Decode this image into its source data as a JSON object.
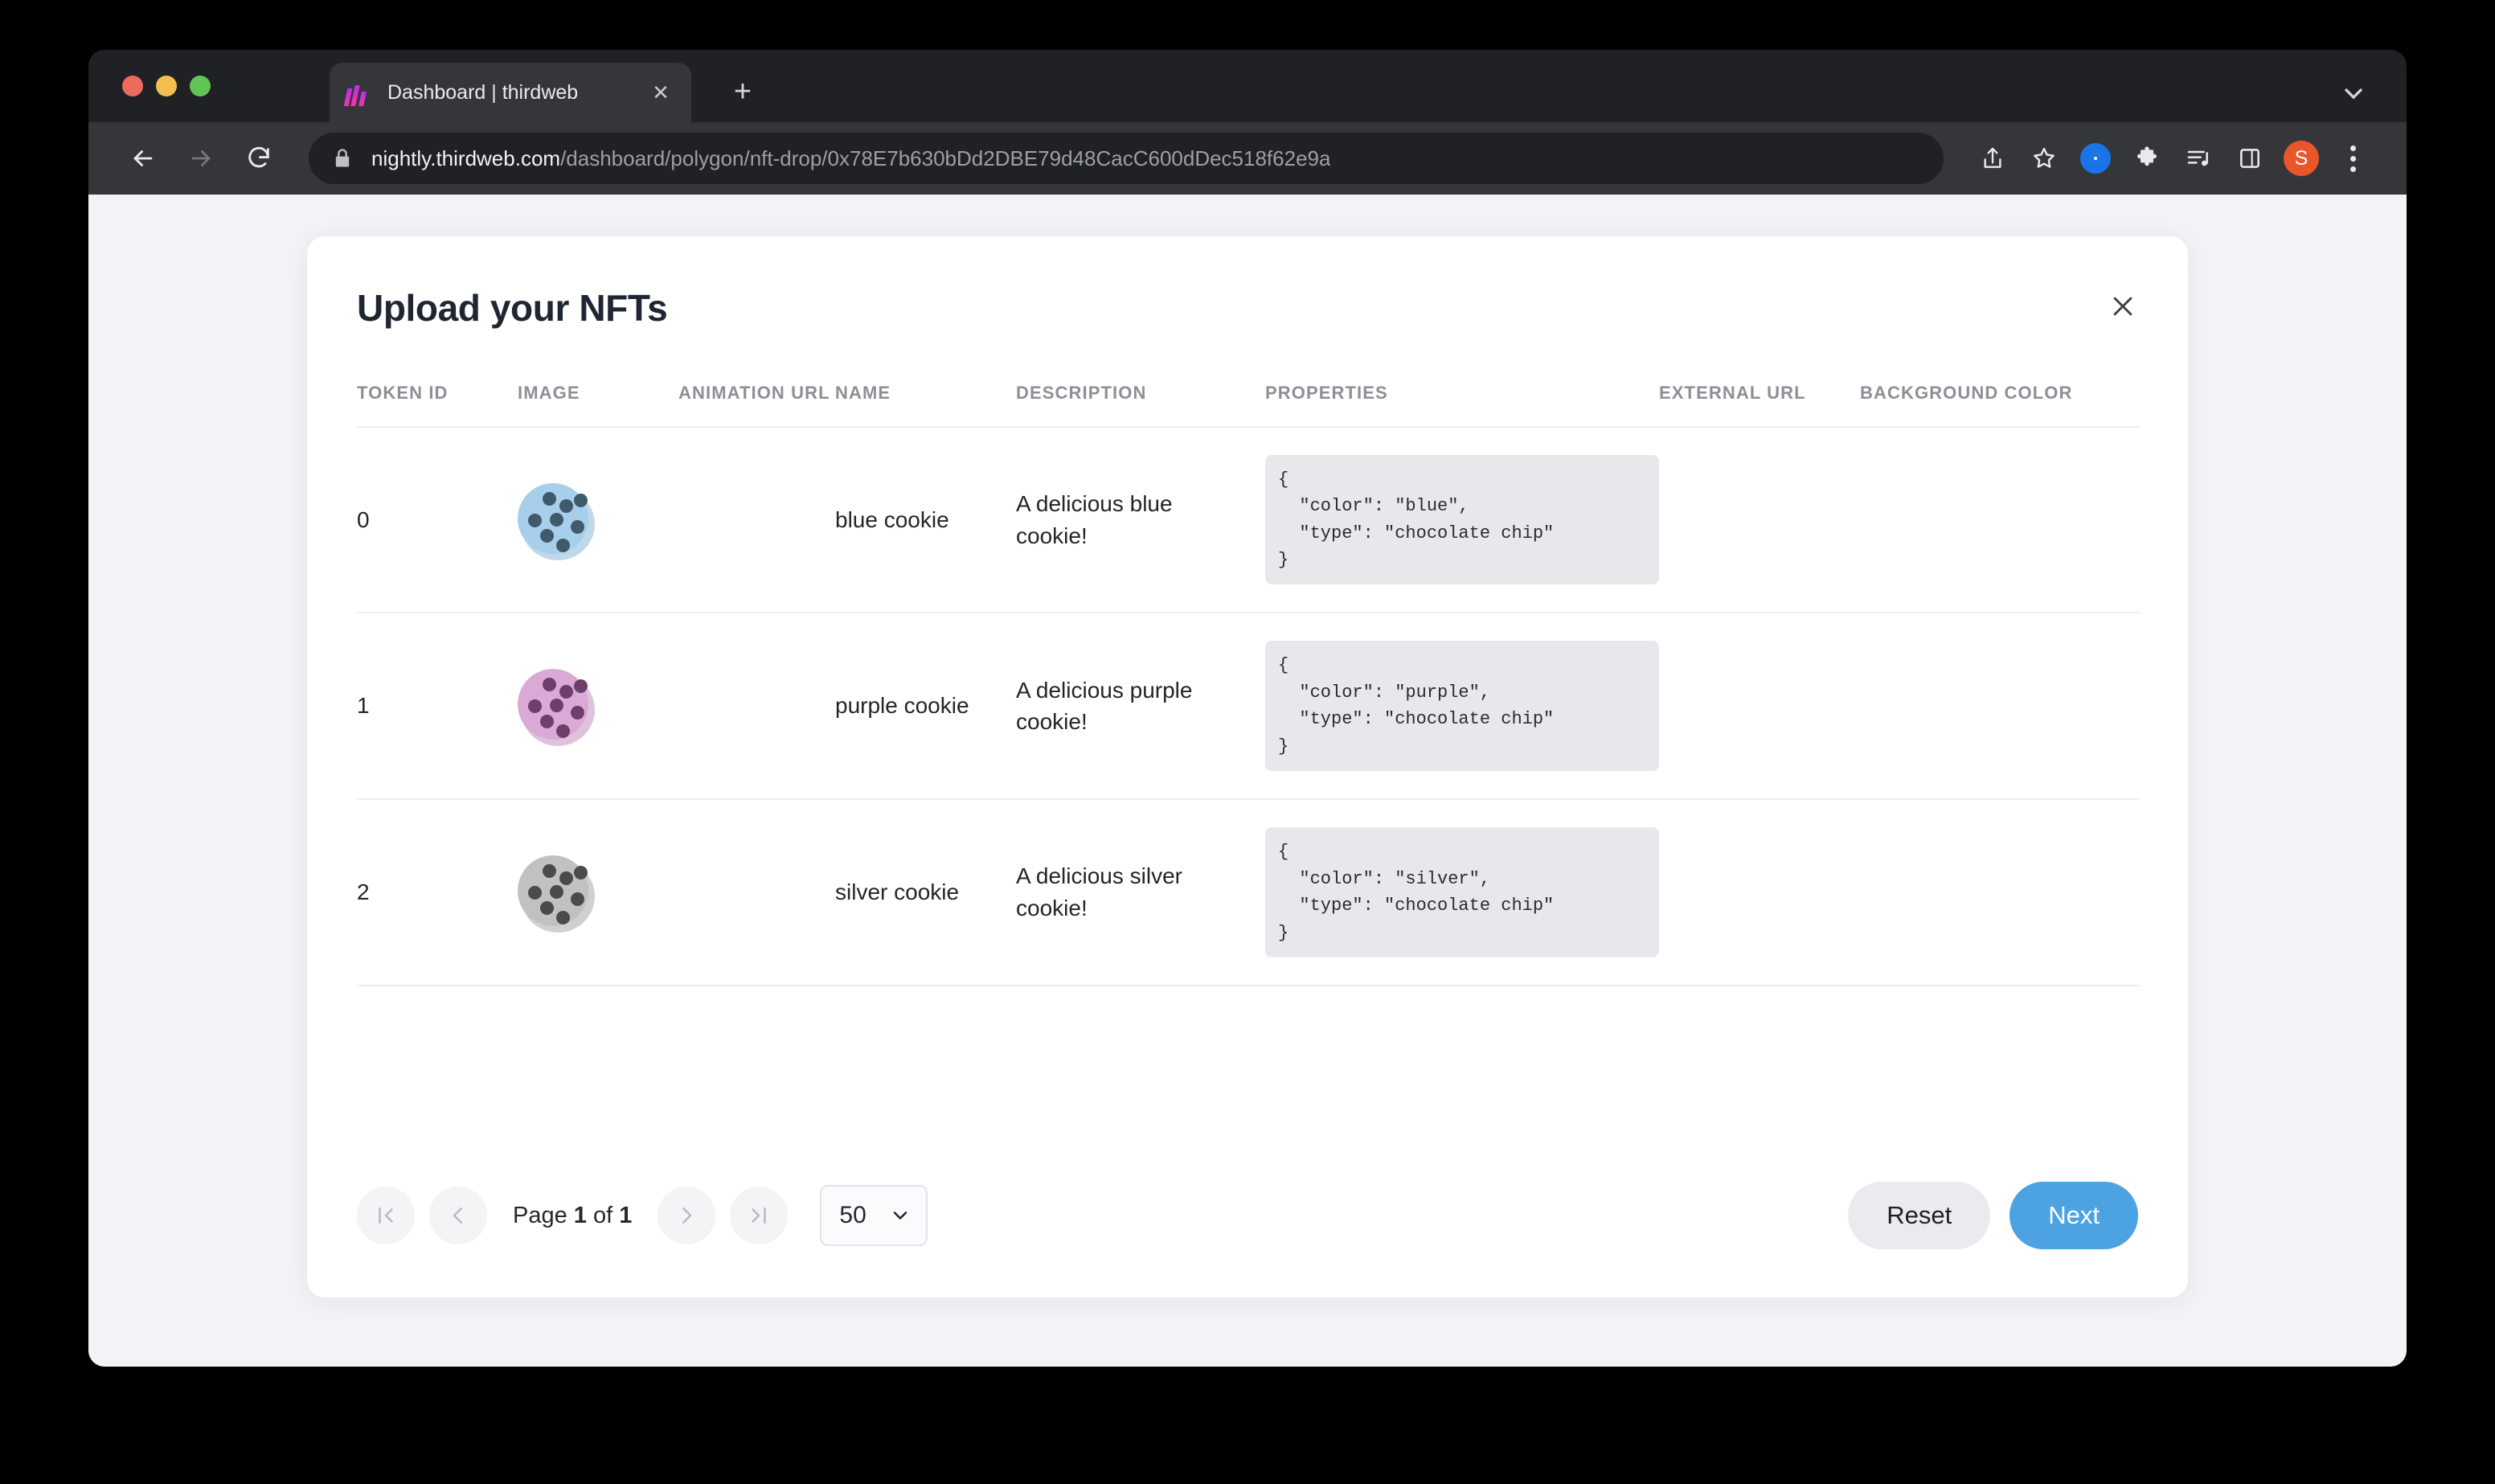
{
  "browser": {
    "tab": {
      "title": "Dashboard | thirdweb",
      "favicon_icon": "thirdweb-logo-icon",
      "close_icon": "close-icon"
    },
    "new_tab_icon": "plus-icon",
    "tabstrip_chevron_icon": "chevron-down-icon",
    "back_icon": "back-arrow-icon",
    "forward_icon": "forward-arrow-icon",
    "reload_icon": "reload-icon",
    "lock_icon": "lock-icon",
    "url_domain": "nightly.thirdweb.com",
    "url_path": "/dashboard/polygon/nft-drop/0x78E7b630bDd2DBE79d48CacC600dDec518f62e9a",
    "toolbar_icons": [
      "share-icon",
      "bookmark-star-icon",
      "extension-blue-circle-icon",
      "puzzle-piece-icon",
      "media-playlist-icon",
      "side-panel-icon"
    ],
    "profile_initial": "S",
    "menu_icon": "kebab-menu-icon"
  },
  "modal": {
    "title": "Upload your NFTs",
    "close_icon": "close-icon"
  },
  "table": {
    "headers": [
      "TOKEN ID",
      "IMAGE",
      "ANIMATION URL",
      "NAME",
      "DESCRIPTION",
      "PROPERTIES",
      "EXTERNAL URL",
      "BACKGROUND COLOR"
    ],
    "rows": [
      {
        "token_id": "0",
        "image_icon": "blue-cookie-image",
        "image_colors": {
          "body": "#A7CFEB",
          "shadow": "#8DB8D8",
          "chip": "#40596B"
        },
        "animation_url": "",
        "name": "blue cookie",
        "description": "A delicious blue cookie!",
        "properties": "{\n  \"color\": \"blue\",\n  \"type\": \"chocolate chip\"\n}",
        "external_url": "",
        "background_color": ""
      },
      {
        "token_id": "1",
        "image_icon": "purple-cookie-image",
        "image_colors": {
          "body": "#DBA9D6",
          "shadow": "#C492C0",
          "chip": "#6E3F6B"
        },
        "animation_url": "",
        "name": "purple cookie",
        "description": "A delicious purple cookie!",
        "properties": "{\n  \"color\": \"purple\",\n  \"type\": \"chocolate chip\"\n}",
        "external_url": "",
        "background_color": ""
      },
      {
        "token_id": "2",
        "image_icon": "silver-cookie-image",
        "image_colors": {
          "body": "#C1C1C1",
          "shadow": "#A9A9A9",
          "chip": "#4B4B4B"
        },
        "animation_url": "",
        "name": "silver cookie",
        "description": "A delicious silver cookie!",
        "properties": "{\n  \"color\": \"silver\",\n  \"type\": \"chocolate chip\"\n}",
        "external_url": "",
        "background_color": ""
      }
    ]
  },
  "pagination": {
    "first_icon": "first-page-icon",
    "prev_icon": "previous-page-icon",
    "next_icon": "next-page-icon",
    "last_icon": "last-page-icon",
    "label_prefix": "Page ",
    "current_page": "1",
    "label_middle": " of ",
    "total_pages": "1",
    "page_size": "50",
    "page_size_chevron_icon": "chevron-down-icon"
  },
  "actions": {
    "reset_label": "Reset",
    "next_label": "Next",
    "next_color": "#4DA2E2"
  }
}
